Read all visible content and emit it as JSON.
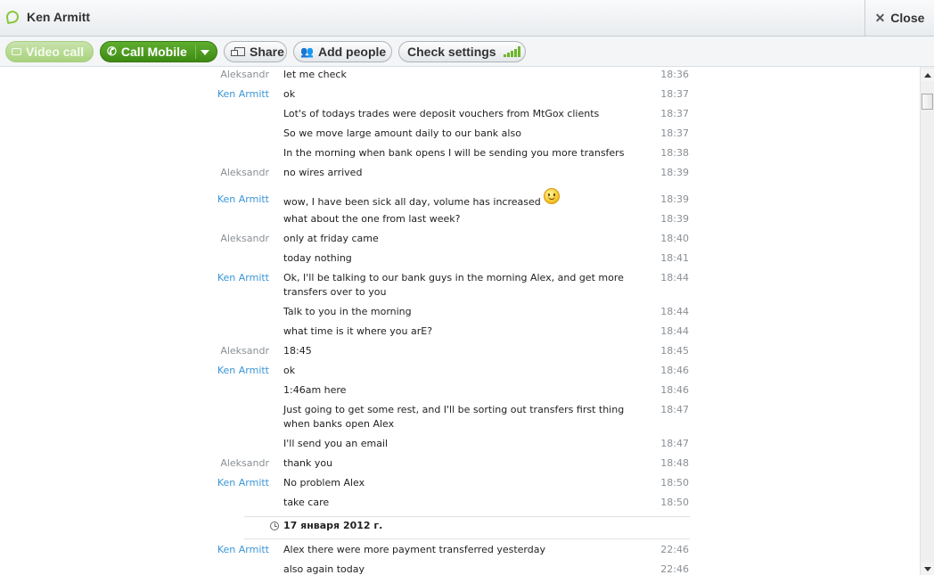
{
  "window": {
    "title": "Ken Armitt",
    "close_label": "Close"
  },
  "toolbar": {
    "video_call": "Video call",
    "call_mobile": "Call Mobile",
    "share": "Share",
    "add_people": "Add people",
    "check_settings": "Check settings"
  },
  "colors": {
    "accent_green": "#3e8a14",
    "me_name": "#3b96d6",
    "other_name": "#8a8f94"
  },
  "messages": [
    {
      "sender": "Aleksandr",
      "text": "let me check",
      "time": "18:36"
    },
    {
      "sender": "Ken Armitt",
      "text": "ok",
      "time": "18:37"
    },
    {
      "sender": "",
      "text": "Lot's of todays trades were deposit vouchers from MtGox clients",
      "time": "18:37"
    },
    {
      "sender": "",
      "text": "So we move large amount daily to our bank also",
      "time": "18:37"
    },
    {
      "sender": "",
      "text": "In the morning when bank opens I will be sending you more transfers",
      "time": "18:38"
    },
    {
      "sender": "Aleksandr",
      "text": "no wires arrived",
      "time": "18:39"
    },
    {
      "sender": "Ken Armitt",
      "text": "wow, I have been sick all day, volume has increased",
      "time": "18:39",
      "icon": "smiley-icon"
    },
    {
      "sender": "",
      "text": "what about the one from last week?",
      "time": "18:39"
    },
    {
      "sender": "Aleksandr",
      "text": "only at friday came",
      "time": "18:40"
    },
    {
      "sender": "",
      "text": "today nothing",
      "time": "18:41"
    },
    {
      "sender": "Ken Armitt",
      "text": "Ok, I'll be talking to our bank guys in the morning Alex, and get more transfers over to you",
      "time": "18:44"
    },
    {
      "sender": "",
      "text": "Talk to you in the morning",
      "time": "18:44"
    },
    {
      "sender": "",
      "text": "what time is it where you arE?",
      "time": "18:44"
    },
    {
      "sender": "Aleksandr",
      "text": "18:45",
      "time": "18:45"
    },
    {
      "sender": "Ken Armitt",
      "text": "ok",
      "time": "18:46"
    },
    {
      "sender": "",
      "text": "1:46am here",
      "time": "18:46"
    },
    {
      "sender": "",
      "text": "Just going to get some rest, and I'll be sorting out transfers first thing when banks open Alex",
      "time": "18:47"
    },
    {
      "sender": "",
      "text": "I'll send you an email",
      "time": "18:47"
    },
    {
      "sender": "Aleksandr",
      "text": "thank you",
      "time": "18:48"
    },
    {
      "sender": "Ken Armitt",
      "text": "No problem Alex",
      "time": "18:50"
    },
    {
      "sender": "",
      "text": "take care",
      "time": "18:50"
    }
  ],
  "date_separator": "17 января 2012 г.",
  "messages_after": [
    {
      "sender": "Ken Armitt",
      "text": "Alex there were more payment transferred yesterday",
      "time": "22:46"
    },
    {
      "sender": "",
      "text": "also again today",
      "time": "22:46"
    }
  ]
}
